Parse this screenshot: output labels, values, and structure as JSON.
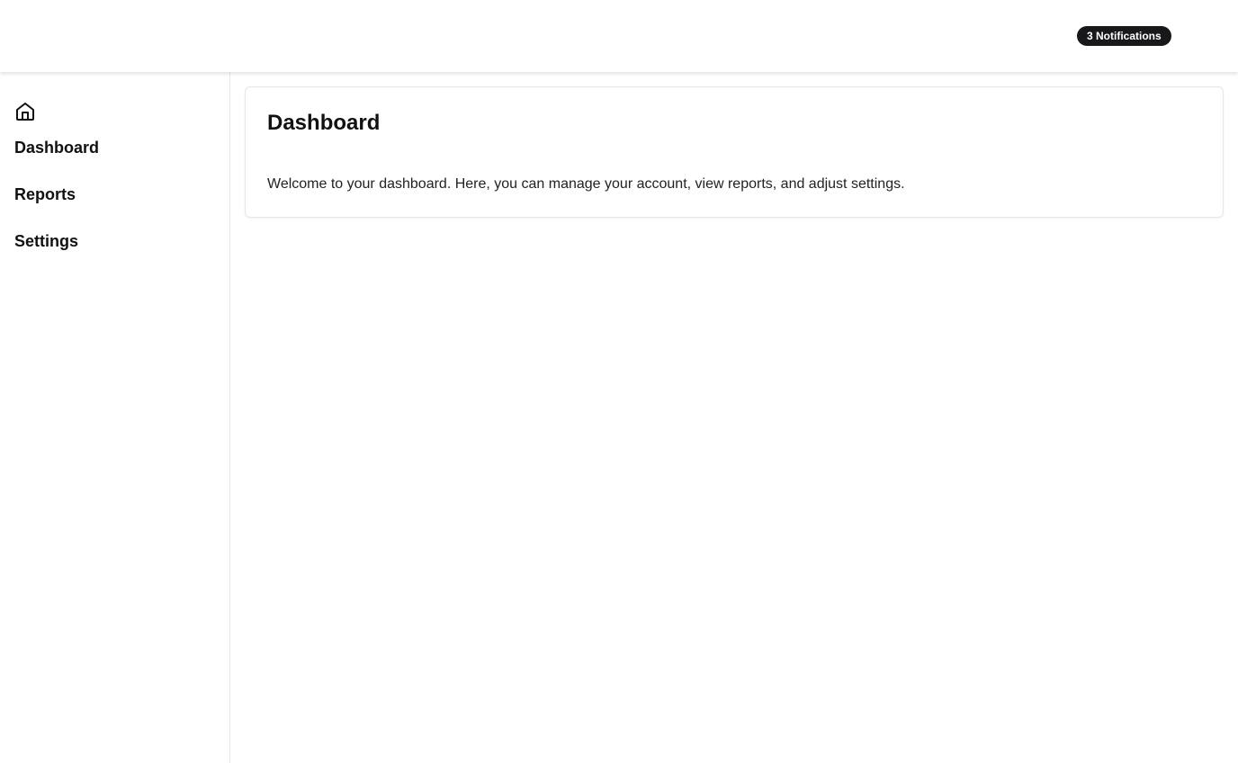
{
  "header": {
    "notifications_label": "3 Notifications"
  },
  "sidebar": {
    "items": [
      {
        "label": "Dashboard",
        "icon": "home-icon"
      },
      {
        "label": "Reports"
      },
      {
        "label": "Settings"
      }
    ]
  },
  "main": {
    "title": "Dashboard",
    "description": "Welcome to your dashboard. Here, you can manage your account, view reports, and adjust settings."
  }
}
